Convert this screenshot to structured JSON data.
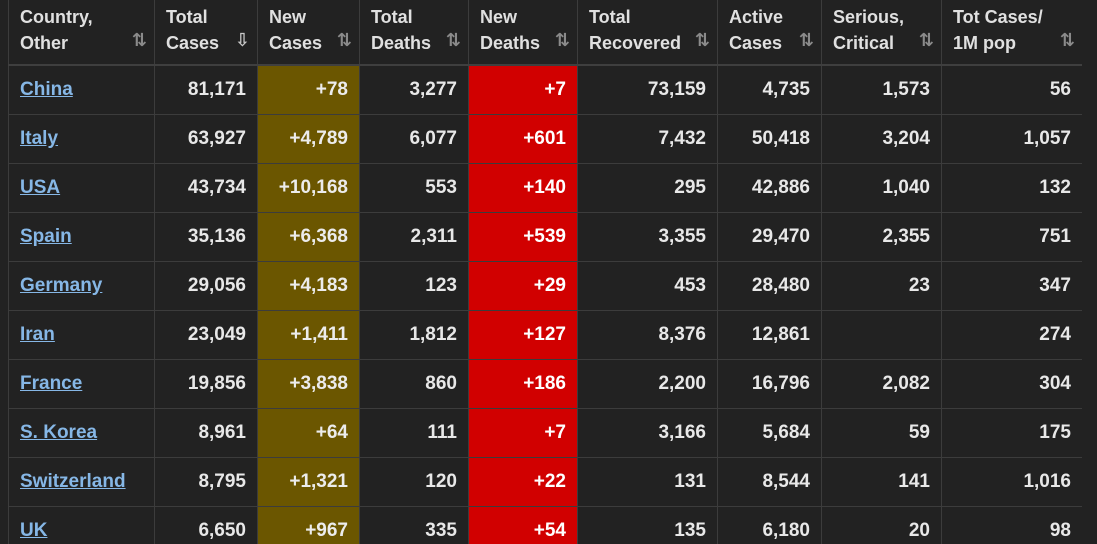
{
  "headers": [
    {
      "line1": "Country,",
      "line2": "Other",
      "sort": "⇅",
      "active": false
    },
    {
      "line1": "Total",
      "line2": "Cases",
      "sort": "⇩",
      "active": true
    },
    {
      "line1": "New",
      "line2": "Cases",
      "sort": "⇅",
      "active": false
    },
    {
      "line1": "Total",
      "line2": "Deaths",
      "sort": "⇅",
      "active": false
    },
    {
      "line1": "New",
      "line2": "Deaths",
      "sort": "⇅",
      "active": false
    },
    {
      "line1": "Total",
      "line2": "Recovered",
      "sort": "⇅",
      "active": false
    },
    {
      "line1": "Active",
      "line2": "Cases",
      "sort": "⇅",
      "active": false
    },
    {
      "line1": "Serious,",
      "line2": "Critical",
      "sort": "⇅",
      "active": false
    },
    {
      "line1": "Tot Cases/",
      "line2": "1M pop",
      "sort": "⇅",
      "active": false
    }
  ],
  "rows": [
    {
      "country": "China",
      "total_cases": "81,171",
      "new_cases": "+78",
      "total_deaths": "3,277",
      "new_deaths": "+7",
      "total_recovered": "73,159",
      "active_cases": "4,735",
      "serious_critical": "1,573",
      "tot_cases_per_1m": "56"
    },
    {
      "country": "Italy",
      "total_cases": "63,927",
      "new_cases": "+4,789",
      "total_deaths": "6,077",
      "new_deaths": "+601",
      "total_recovered": "7,432",
      "active_cases": "50,418",
      "serious_critical": "3,204",
      "tot_cases_per_1m": "1,057"
    },
    {
      "country": "USA",
      "total_cases": "43,734",
      "new_cases": "+10,168",
      "total_deaths": "553",
      "new_deaths": "+140",
      "total_recovered": "295",
      "active_cases": "42,886",
      "serious_critical": "1,040",
      "tot_cases_per_1m": "132"
    },
    {
      "country": "Spain",
      "total_cases": "35,136",
      "new_cases": "+6,368",
      "total_deaths": "2,311",
      "new_deaths": "+539",
      "total_recovered": "3,355",
      "active_cases": "29,470",
      "serious_critical": "2,355",
      "tot_cases_per_1m": "751"
    },
    {
      "country": "Germany",
      "total_cases": "29,056",
      "new_cases": "+4,183",
      "total_deaths": "123",
      "new_deaths": "+29",
      "total_recovered": "453",
      "active_cases": "28,480",
      "serious_critical": "23",
      "tot_cases_per_1m": "347"
    },
    {
      "country": "Iran",
      "total_cases": "23,049",
      "new_cases": "+1,411",
      "total_deaths": "1,812",
      "new_deaths": "+127",
      "total_recovered": "8,376",
      "active_cases": "12,861",
      "serious_critical": "",
      "tot_cases_per_1m": "274"
    },
    {
      "country": "France",
      "total_cases": "19,856",
      "new_cases": "+3,838",
      "total_deaths": "860",
      "new_deaths": "+186",
      "total_recovered": "2,200",
      "active_cases": "16,796",
      "serious_critical": "2,082",
      "tot_cases_per_1m": "304"
    },
    {
      "country": "S. Korea",
      "total_cases": "8,961",
      "new_cases": "+64",
      "total_deaths": "111",
      "new_deaths": "+7",
      "total_recovered": "3,166",
      "active_cases": "5,684",
      "serious_critical": "59",
      "tot_cases_per_1m": "175"
    },
    {
      "country": "Switzerland",
      "total_cases": "8,795",
      "new_cases": "+1,321",
      "total_deaths": "120",
      "new_deaths": "+22",
      "total_recovered": "131",
      "active_cases": "8,544",
      "serious_critical": "141",
      "tot_cases_per_1m": "1,016"
    },
    {
      "country": "UK",
      "total_cases": "6,650",
      "new_cases": "+967",
      "total_deaths": "335",
      "new_deaths": "+54",
      "total_recovered": "135",
      "active_cases": "6,180",
      "serious_critical": "20",
      "tot_cases_per_1m": "98"
    }
  ],
  "colors": {
    "background": "#222222",
    "new_cases_cell": "#6b5600",
    "new_deaths_cell": "#d10000",
    "link": "#86b7e6",
    "text": "#e8e8e8"
  }
}
